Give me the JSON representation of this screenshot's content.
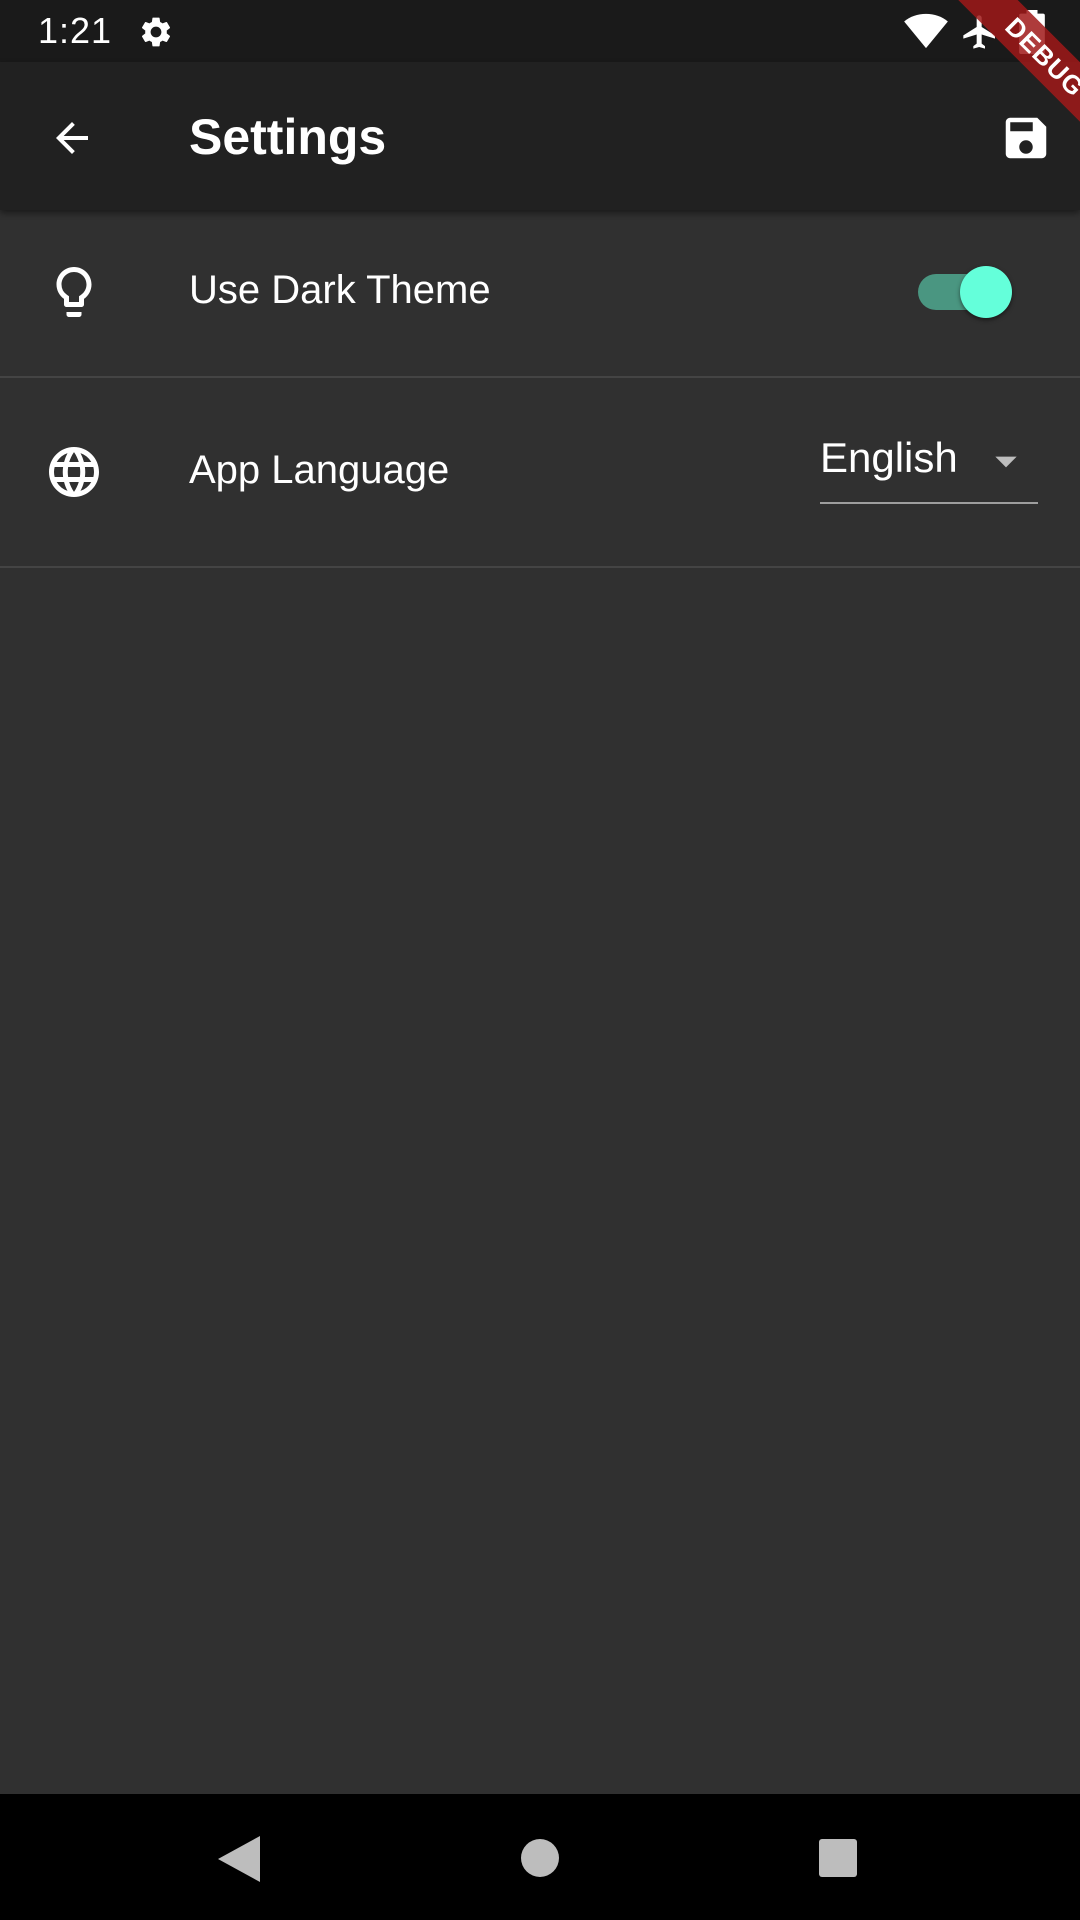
{
  "status_bar": {
    "time": "1:21",
    "icons": [
      "gear-icon",
      "wifi-icon",
      "airplane-icon",
      "battery-icon"
    ]
  },
  "debug_banner": {
    "label": "DEBUG",
    "color": "#a01919"
  },
  "app_bar": {
    "title": "Settings",
    "back_icon": "arrow-back-icon",
    "save_icon": "save-icon"
  },
  "settings": {
    "dark_theme": {
      "icon": "lightbulb-icon",
      "label": "Use Dark Theme",
      "enabled": true
    },
    "language": {
      "icon": "globe-icon",
      "label": "App Language",
      "selected": "English"
    }
  },
  "nav_bar": {
    "icons": [
      "nav-back-icon",
      "nav-home-icon",
      "nav-recents-icon"
    ]
  },
  "colors": {
    "background": "#303030",
    "app_bar": "#212121",
    "accent": "#64ffda",
    "divider": "#444444"
  }
}
